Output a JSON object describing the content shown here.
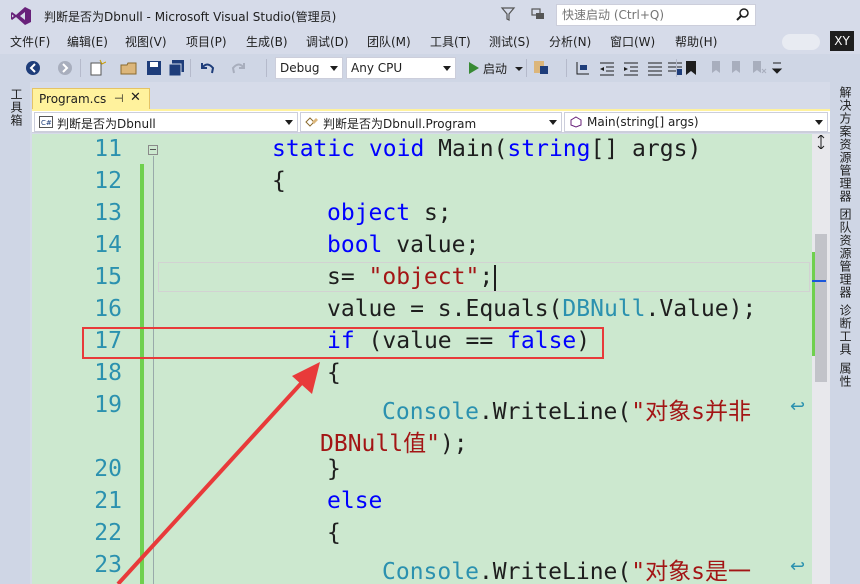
{
  "window": {
    "title": "判断是否为Dbnull - Microsoft Visual Studio(管理员)",
    "quick_launch_placeholder": "快速启动 (Ctrl+Q)",
    "user_initials": "XY"
  },
  "menu": [
    "文件(F)",
    "编辑(E)",
    "视图(V)",
    "项目(P)",
    "生成(B)",
    "调试(D)",
    "团队(M)",
    "工具(T)",
    "测试(S)",
    "分析(N)",
    "窗口(W)",
    "帮助(H)"
  ],
  "toolbar": {
    "config": "Debug",
    "platform": "Any CPU",
    "start_label": "启动"
  },
  "left_panel": {
    "label": "工具箱"
  },
  "right_panel": {
    "labels": [
      "解决方案资源管理器",
      "团队资源管理器",
      "诊断工具",
      "属性"
    ]
  },
  "tab": {
    "label": "Program.cs",
    "pin": "⊣",
    "close": "✕"
  },
  "navbar": {
    "project": "判断是否为Dbnull",
    "class": "判断是否为Dbnull.Program",
    "member": "Main(string[] args)"
  },
  "editor": {
    "line_numbers": [
      "11",
      "12",
      "13",
      "14",
      "15",
      "16",
      "17",
      "18",
      "19",
      "20",
      "21",
      "22",
      "23"
    ],
    "code": {
      "l11_kw": "static void",
      "l11_name": " Main(",
      "l11_type": "string",
      "l11_rest": "[] args)",
      "l12": "{",
      "l13_type": "object",
      "l13_rest": " s;",
      "l14_type": "bool",
      "l14_rest": " value;",
      "l15_a": "s= ",
      "l15_str": "\"object\"",
      "l15_b": ";",
      "l16_a": "value = s.Equals(",
      "l16_type": "DBNull",
      "l16_b": ".Value);",
      "l17_kw": "if",
      "l17_a": " (value == ",
      "l17_kw2": "false",
      "l17_b": ")",
      "l18": "{",
      "l19_type": "Console",
      "l19_a": ".WriteLine(",
      "l19_str": "\"对象s并非",
      "l19_cont": "DBNull值\"",
      "l19_end": ");",
      "l20": "}",
      "l21_kw": "else",
      "l22": "{",
      "l23_type": "Console",
      "l23_a": ".WriteLine(",
      "l23_str": "\"对象s是一"
    },
    "wrap_glyph": "↩"
  },
  "colors": {
    "editor_bg": "#cce8cf",
    "keyword": "#0000ff",
    "type": "#2b91af",
    "string": "#a31515",
    "highlight": "#e83a3a",
    "tab_active": "#fff29d"
  }
}
